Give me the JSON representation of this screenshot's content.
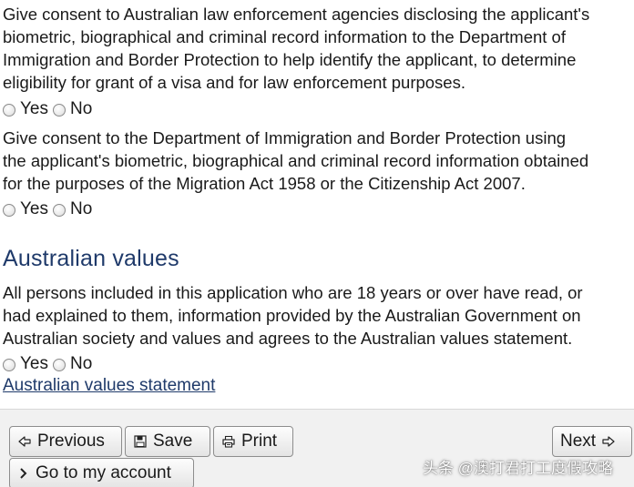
{
  "consent1": {
    "lines": [
      "Give consent to Australian law enforcement agencies disclosing the applicant's",
      "biometric, biographical and criminal record information to the Department of",
      "Immigration and Border Protection to help identify the applicant, to determine",
      "eligibility for grant of a visa and for law enforcement purposes."
    ],
    "yes_label": "Yes",
    "no_label": "No"
  },
  "consent2": {
    "lines": [
      "Give consent to the Department of Immigration and Border Protection using",
      "the applicant's biometric, biographical and criminal record information obtained",
      "for the purposes of the Migration Act 1958 or the Citizenship Act 2007."
    ],
    "yes_label": "Yes",
    "no_label": "No"
  },
  "values": {
    "heading": "Australian values",
    "lines": [
      "All persons included in this application who are 18 years or over have read, or",
      "had explained to them, information provided by the Australian Government on",
      "Australian society and values and agrees to the Australian values statement."
    ],
    "yes_label": "Yes",
    "no_label": "No",
    "link_label": "Australian values statement"
  },
  "buttons": {
    "previous": "Previous",
    "save": "Save",
    "print": "Print",
    "next": "Next",
    "account": "Go to my account"
  },
  "icons": {
    "previous": "arrow-left-icon",
    "save": "floppy-disk-icon",
    "print": "printer-icon",
    "next": "arrow-right-icon",
    "account": "chevron-right-icon"
  },
  "watermark": "头条 @澳打君打工度假攻略",
  "colors": {
    "heading": "#1f3a6a",
    "link": "#1f3a6a",
    "button_bar": "#f1f1f1"
  }
}
